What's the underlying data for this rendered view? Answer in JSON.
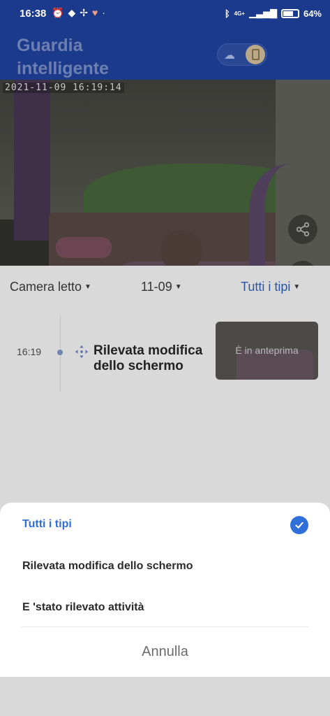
{
  "status_bar": {
    "time": "16:38",
    "left_icons": [
      "alarm-icon",
      "notification-icon",
      "fan-icon",
      "heart-icon",
      "dot-icon"
    ],
    "network": "4G+",
    "battery_text": "64%",
    "battery_level": 0.64
  },
  "header": {
    "title": "Guardia intelligente"
  },
  "camera": {
    "timestamp": "2021-11-09  16:19:14"
  },
  "filters": {
    "camera": "Camera letto",
    "date": "11-09",
    "type": "Tutti i tipi"
  },
  "event": {
    "time": "16:19",
    "title": "Rilevata modifica dello schermo",
    "thumb_label": "È in anteprima"
  },
  "sheet": {
    "options": [
      {
        "label": "Tutti i tipi",
        "selected": true
      },
      {
        "label": "Rilevata modifica dello schermo",
        "selected": false
      },
      {
        "label": "E 'stato rilevato attività",
        "selected": false
      }
    ],
    "cancel": "Annulla"
  },
  "colors": {
    "header_blue": "#1c3a8c",
    "accent_blue": "#2f6fd9"
  }
}
